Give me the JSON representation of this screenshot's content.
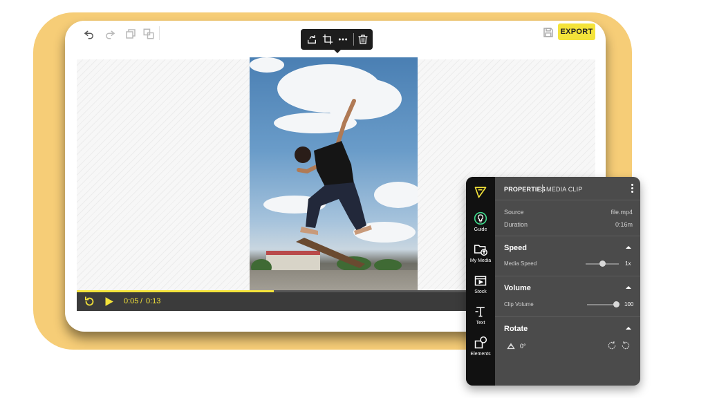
{
  "topbar": {
    "undo_icon": "undo-icon",
    "redo_icon": "redo-icon",
    "duplicate_icon": "duplicate-icon",
    "group_icon": "group-icon",
    "save_icon": "save-icon",
    "export_label": "EXPORT",
    "export_color": "#f4e33a"
  },
  "clip_toolbar": {
    "icons": [
      "replace-icon",
      "crop-icon",
      "more-icon",
      "trash-icon"
    ]
  },
  "player": {
    "current_time": "0:05",
    "separator": "/",
    "total_time": "0:13",
    "progress_fraction": 0.38,
    "accent_color": "#f4e33a"
  },
  "sidebar": {
    "items": [
      {
        "label": "Guide",
        "icon": "bulb-icon"
      },
      {
        "label": "My Media",
        "icon": "folder-upload-icon"
      },
      {
        "label": "Stock",
        "icon": "stock-video-icon"
      },
      {
        "label": "Text",
        "icon": "text-icon"
      },
      {
        "label": "Elements",
        "icon": "shapes-icon"
      }
    ]
  },
  "properties": {
    "title": "PROPERTIES",
    "subtitle": "MEDIA CLIP",
    "source_label": "Source",
    "source_value": "file.mp4",
    "duration_label": "Duration",
    "duration_value": "0:16m",
    "speed": {
      "title": "Speed",
      "control_label": "Media Speed",
      "value": "1x",
      "slider_fraction": 0.5
    },
    "volume": {
      "title": "Volume",
      "control_label": "Clip Volume",
      "value": "100",
      "slider_fraction": 1.0
    },
    "rotate": {
      "title": "Rotate",
      "value": "0°"
    }
  }
}
